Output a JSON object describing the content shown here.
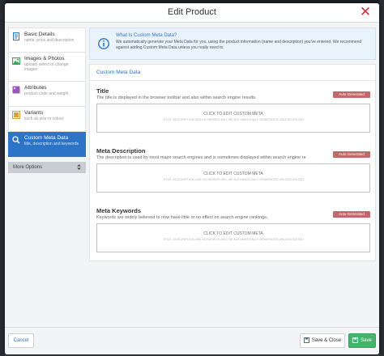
{
  "modal": {
    "title": "Edit Product",
    "close_glyph": "✕"
  },
  "sidebar": {
    "items": [
      {
        "label": "Basic Details",
        "sub": "name, price and description",
        "icon": "document-icon",
        "color": "#2b74c6"
      },
      {
        "label": "Images & Photos",
        "sub": "upload, select or change images",
        "icon": "image-icon",
        "color": "#3aa655"
      },
      {
        "label": "Attributes",
        "sub": "product code and weight",
        "icon": "tag-icon",
        "color": "#9b59b6"
      },
      {
        "label": "Variants",
        "sub": "such as size or colour",
        "icon": "variants-icon",
        "color": "#e0a030"
      },
      {
        "label": "Custom Meta Data",
        "sub": "title, description and keywords",
        "icon": "search-icon",
        "color": "#ffffff"
      }
    ],
    "more_options": "More Options"
  },
  "info": {
    "title": "What Is Custom Meta Data?",
    "body": "We automatically generate your Meta Data for you, using the product information (name and description) you've entered. We recommend against adding Custom Meta Data unless you really need to."
  },
  "panel": {
    "header": "Custom Meta Data",
    "fields": [
      {
        "title": "Title",
        "desc": "The title is displayed in the browser toolbar and also within search engine results.",
        "badge": "Auto Generated",
        "edit": "CLICK TO EDIT CUSTOM META",
        "note": "TITLE, DESCRIPTION AND KEYWORDS WILL BE AUTOMATICALLY GENERATED UNLESS EDITED"
      },
      {
        "title": "Meta Description",
        "desc": "The description is used by most major search engines and is sometimes displayed within search engine re",
        "badge": "Auto Generated",
        "edit": "CLICK TO EDIT CUSTOM META",
        "note": "TITLE, DESCRIPTION AND KEYWORDS WILL BE AUTOMATICALLY GENERATED UNLESS EDITED"
      },
      {
        "title": "Meta Keywords",
        "desc": "Keywords are widely believed to now have little or no effect on search engine rankings.",
        "badge": "Auto Generated",
        "edit": "CLICK TO EDIT CUSTOM META",
        "note": "TITLE, DESCRIPTION AND KEYWORDS WILL BE AUTOMATICALLY GENERATED UNLESS EDITED"
      }
    ]
  },
  "footer": {
    "cancel": "Cancel",
    "save_close": "Save & Close",
    "save": "Save"
  },
  "colors": {
    "accent": "#2b74c6",
    "danger": "#d0323a",
    "success": "#46b36b",
    "badge": "#c0686a"
  }
}
